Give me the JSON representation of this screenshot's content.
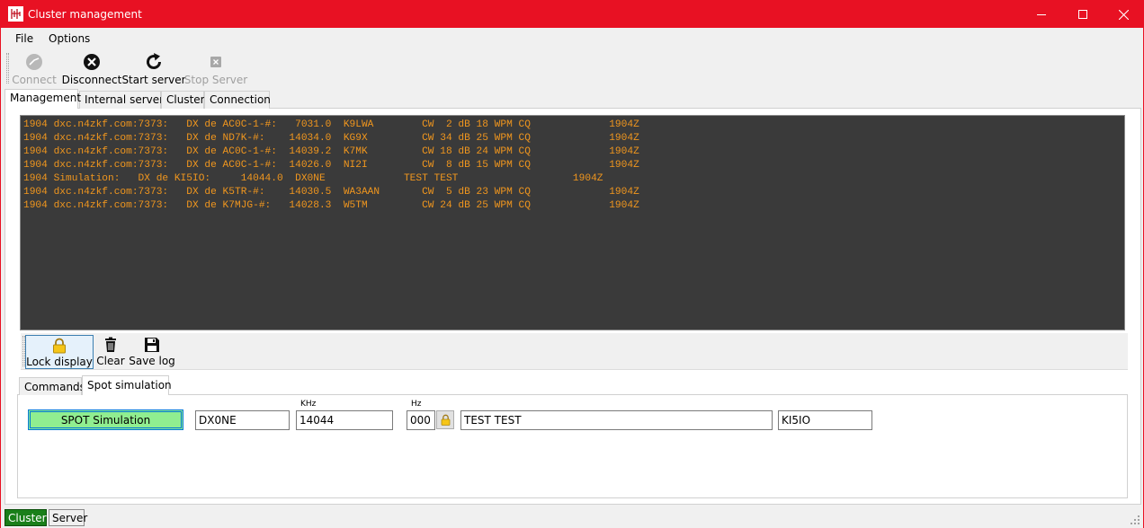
{
  "window": {
    "title": "Cluster management",
    "title_bar_color": "#e81123",
    "icon": "antenna-app-icon"
  },
  "menu": {
    "file": "File",
    "options": "Options"
  },
  "toolbar": {
    "connect": "Connect",
    "disconnect": "Disconnect",
    "start_server": "Start server",
    "stop_server": "Stop Server"
  },
  "tabs": [
    "Management",
    "Internal server",
    "Cluster",
    "Connection"
  ],
  "console": {
    "text_color": "#f0961e",
    "background": "#3a3a3a",
    "lines": [
      "1904 dxc.n4zkf.com:7373:   DX de AC0C-1-#:   7031.0  K9LWA        CW  2 dB 18 WPM CQ             1904Z",
      "1904 dxc.n4zkf.com:7373:   DX de ND7K-#:    14034.0  KG9X         CW 34 dB 25 WPM CQ             1904Z",
      "1904 dxc.n4zkf.com:7373:   DX de AC0C-1-#:  14039.2  K7MK         CW 18 dB 24 WPM CQ             1904Z",
      "1904 dxc.n4zkf.com:7373:   DX de AC0C-1-#:  14026.0  NI2I         CW  8 dB 15 WPM CQ             1904Z",
      "1904 Simulation:   DX de KI5IO:     14044.0  DX0NE             TEST TEST                   1904Z",
      "1904 dxc.n4zkf.com:7373:   DX de K5TR-#:    14030.5  WA3AAN       CW  5 dB 23 WPM CQ             1904Z",
      "1904 dxc.n4zkf.com:7373:   DX de K7MJG-#:   14028.3  W5TM         CW 24 dB 25 WPM CQ             1904Z"
    ]
  },
  "console_toolbar": {
    "lock_display": "Lock display",
    "clear": "Clear",
    "save_log": "Save log"
  },
  "sub_tabs": [
    "Commands",
    "Spot simulation"
  ],
  "spot_simulation": {
    "button_label": "SPOT Simulation",
    "button_color": "#90ee90",
    "callsign": "DX0NE",
    "khz_label": "KHz",
    "frequency_khz": "14044",
    "hz_label": "Hz",
    "frequency_hz": "000",
    "comment": "TEST TEST",
    "spotter": "KI5IO"
  },
  "statusbar": {
    "cluster": "Cluster",
    "server": "Server",
    "cluster_color": "#1a7f1a"
  }
}
